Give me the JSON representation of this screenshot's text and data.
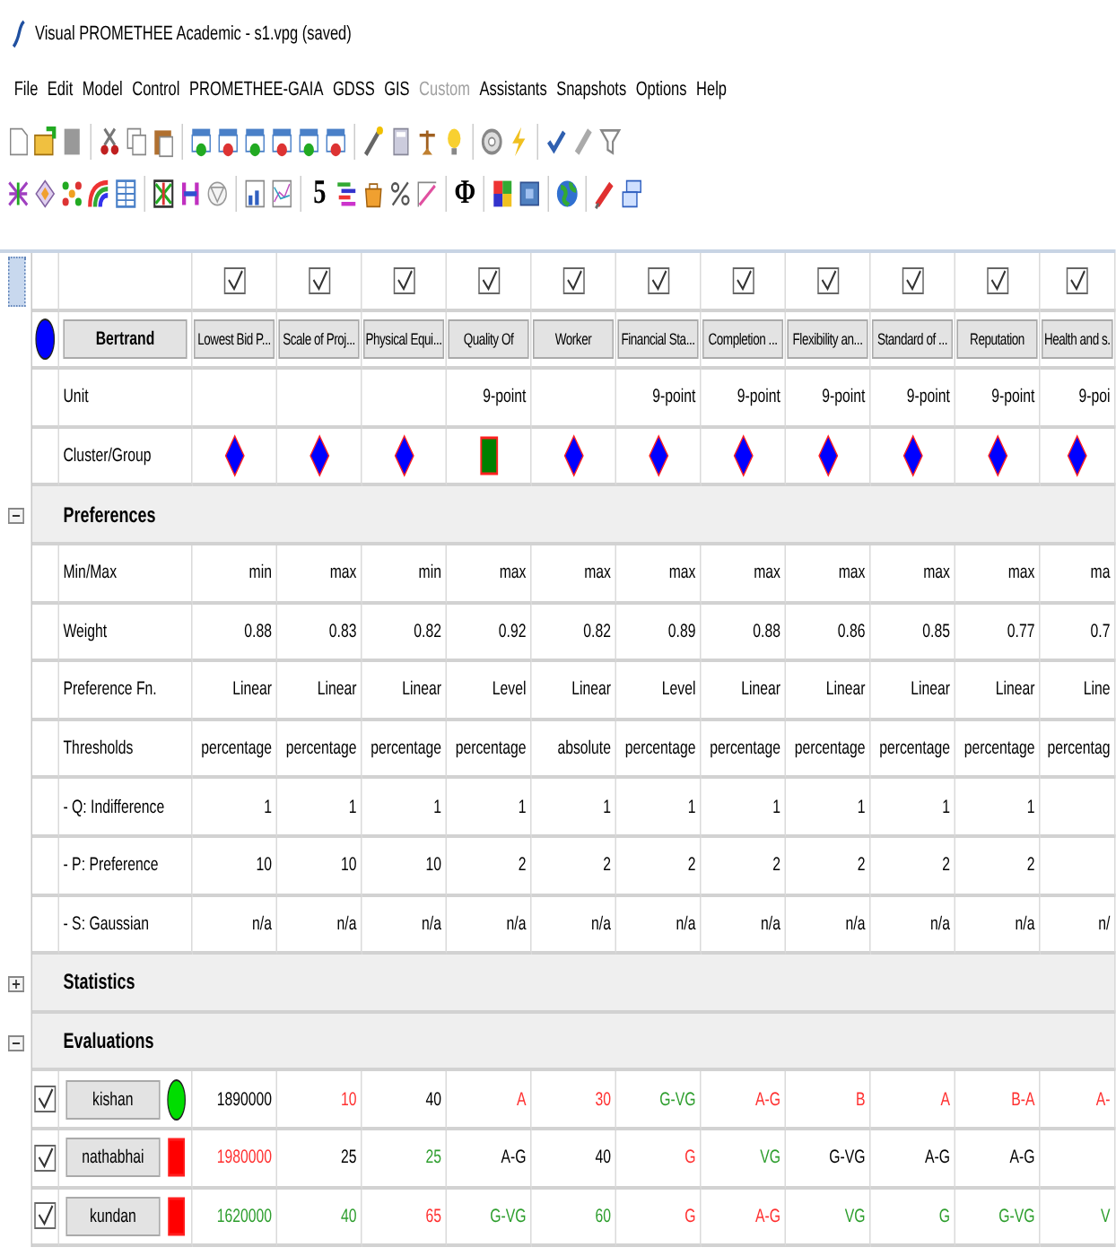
{
  "window": {
    "title": "Visual PROMETHEE Academic - s1.vpg (saved)"
  },
  "menu": [
    {
      "label": "File",
      "disabled": false
    },
    {
      "label": "Edit",
      "disabled": false
    },
    {
      "label": "Model",
      "disabled": false
    },
    {
      "label": "Control",
      "disabled": false
    },
    {
      "label": "PROMETHEE-GAIA",
      "disabled": false
    },
    {
      "label": "GDSS",
      "disabled": false
    },
    {
      "label": "GIS",
      "disabled": false
    },
    {
      "label": "Custom",
      "disabled": true
    },
    {
      "label": "Assistants",
      "disabled": false
    },
    {
      "label": "Snapshots",
      "disabled": false
    },
    {
      "label": "Options",
      "disabled": false
    },
    {
      "label": "Help",
      "disabled": false
    }
  ],
  "toolbar_glyphs": [
    "5",
    "Φ"
  ],
  "scenario": {
    "name": "Bertrand",
    "color": "#0000ff"
  },
  "unit_label": "Unit",
  "group_label": "Cluster/Group",
  "criteria": [
    {
      "name": "Lowest Bid P...",
      "checked": true,
      "group": {
        "kind": "diamond",
        "color": "#0000ff"
      }
    },
    {
      "name": "Scale of Proj...",
      "checked": true,
      "group": {
        "kind": "diamond",
        "color": "#0000ff"
      }
    },
    {
      "name": "Physical Equi...",
      "checked": true,
      "group": {
        "kind": "diamond",
        "color": "#0000ff"
      }
    },
    {
      "name": "Quality Of",
      "checked": true,
      "unit": "9-point",
      "group": {
        "kind": "square",
        "color": "#008000"
      }
    },
    {
      "name": "Worker",
      "checked": true,
      "group": {
        "kind": "diamond",
        "color": "#0000ff"
      }
    },
    {
      "name": "Financial Sta...",
      "checked": true,
      "unit": "9-point",
      "group": {
        "kind": "diamond",
        "color": "#0000ff"
      }
    },
    {
      "name": "Completion ...",
      "checked": true,
      "unit": "9-point",
      "group": {
        "kind": "diamond",
        "color": "#0000ff"
      }
    },
    {
      "name": "Flexibility an...",
      "checked": true,
      "unit": "9-point",
      "group": {
        "kind": "diamond",
        "color": "#0000ff"
      }
    },
    {
      "name": "Standard of ...",
      "checked": true,
      "unit": "9-point",
      "group": {
        "kind": "diamond",
        "color": "#0000ff"
      }
    },
    {
      "name": "Reputation",
      "checked": true,
      "unit": "9-point",
      "group": {
        "kind": "diamond",
        "color": "#0000ff"
      }
    },
    {
      "name": "Health and s.",
      "checked": true,
      "unit": "9-poi",
      "group": {
        "kind": "diamond",
        "color": "#0000ff"
      }
    }
  ],
  "preferences": {
    "label": "Preferences",
    "expanded": true,
    "rows": [
      {
        "label": "Min/Max",
        "values": [
          "min",
          "max",
          "min",
          "max",
          "max",
          "max",
          "max",
          "max",
          "max",
          "max",
          "ma"
        ]
      },
      {
        "label": "Weight",
        "values": [
          "0.88",
          "0.83",
          "0.82",
          "0.92",
          "0.82",
          "0.89",
          "0.88",
          "0.86",
          "0.85",
          "0.77",
          "0.7"
        ]
      },
      {
        "label": "Preference Fn.",
        "values": [
          "Linear",
          "Linear",
          "Linear",
          "Level",
          "Linear",
          "Level",
          "Linear",
          "Linear",
          "Linear",
          "Linear",
          "Line"
        ]
      },
      {
        "label": "Thresholds",
        "values": [
          "percentage",
          "percentage",
          "percentage",
          "percentage",
          "absolute",
          "percentage",
          "percentage",
          "percentage",
          "percentage",
          "percentage",
          "percentag"
        ]
      },
      {
        "label": "- Q: Indifference",
        "values": [
          "1",
          "1",
          "1",
          "1",
          "1",
          "1",
          "1",
          "1",
          "1",
          "1"
        ]
      },
      {
        "label": "- P: Preference",
        "values": [
          "10",
          "10",
          "10",
          "2",
          "2",
          "2",
          "2",
          "2",
          "2",
          "2"
        ]
      },
      {
        "label": "- S: Gaussian",
        "values": [
          "n/a",
          "n/a",
          "n/a",
          "n/a",
          "n/a",
          "n/a",
          "n/a",
          "n/a",
          "n/a",
          "n/a",
          "n/"
        ]
      }
    ]
  },
  "statistics": {
    "label": "Statistics",
    "expanded": false
  },
  "evaluations": {
    "label": "Evaluations",
    "expanded": true,
    "alternatives": [
      {
        "name": "kishan",
        "checked": true,
        "marker": {
          "kind": "circle",
          "color": "#00dd00"
        },
        "values": [
          {
            "text": "1890000",
            "color": "#000000"
          },
          {
            "text": "10",
            "color": "#ff3030"
          },
          {
            "text": "40",
            "color": "#000000"
          },
          {
            "text": "A",
            "color": "#ff3030"
          },
          {
            "text": "30",
            "color": "#ff3030"
          },
          {
            "text": "G-VG",
            "color": "#2e9e2e"
          },
          {
            "text": "A-G",
            "color": "#ff3030"
          },
          {
            "text": "B",
            "color": "#ff3030"
          },
          {
            "text": "A",
            "color": "#ff3030"
          },
          {
            "text": "B-A",
            "color": "#ff3030"
          },
          {
            "text": "A-",
            "color": "#ff3030"
          }
        ]
      },
      {
        "name": "nathabhai",
        "checked": true,
        "marker": {
          "kind": "square",
          "color": "#ff0000"
        },
        "values": [
          {
            "text": "1980000",
            "color": "#ff3030"
          },
          {
            "text": "25",
            "color": "#000000"
          },
          {
            "text": "25",
            "color": "#2e9e2e"
          },
          {
            "text": "A-G",
            "color": "#000000"
          },
          {
            "text": "40",
            "color": "#000000"
          },
          {
            "text": "G",
            "color": "#ff3030"
          },
          {
            "text": "VG",
            "color": "#2e9e2e"
          },
          {
            "text": "G-VG",
            "color": "#000000"
          },
          {
            "text": "A-G",
            "color": "#000000"
          },
          {
            "text": "A-G",
            "color": "#000000"
          }
        ]
      },
      {
        "name": "kundan",
        "checked": true,
        "marker": {
          "kind": "square",
          "color": "#ff0000"
        },
        "values": [
          {
            "text": "1620000",
            "color": "#2e9e2e"
          },
          {
            "text": "40",
            "color": "#2e9e2e"
          },
          {
            "text": "65",
            "color": "#ff3030"
          },
          {
            "text": "G-VG",
            "color": "#2e9e2e"
          },
          {
            "text": "60",
            "color": "#2e9e2e"
          },
          {
            "text": "G",
            "color": "#ff3030"
          },
          {
            "text": "A-G",
            "color": "#ff3030"
          },
          {
            "text": "VG",
            "color": "#2e9e2e"
          },
          {
            "text": "G",
            "color": "#2e9e2e"
          },
          {
            "text": "G-VG",
            "color": "#2e9e2e"
          },
          {
            "text": "V",
            "color": "#2e9e2e"
          }
        ]
      }
    ]
  }
}
